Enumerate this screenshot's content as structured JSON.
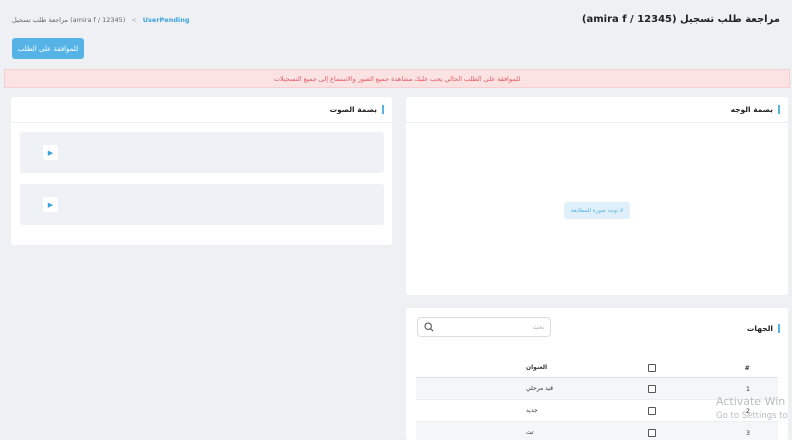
{
  "header": {
    "title": "مراجعة طلب تسجيل (amira f / 12345)",
    "breadcrumb": {
      "link": "UserPending",
      "separator": "<",
      "current": "مراجعة طلب تسجيل (amira f / 12345)"
    }
  },
  "actions": {
    "approve_label": "للموافقة على الطلب"
  },
  "alert": {
    "message": "للموافقة على الطلب الحالي يجب عليك مشاهدة جميع الصور والاستماع إلى جميع التسجيلات"
  },
  "voice_card": {
    "title": "بصمة الصوت",
    "recordings": [
      {
        "play_icon": "▶"
      },
      {
        "play_icon": "▶"
      }
    ]
  },
  "face_card": {
    "title": "بصمة الوجه",
    "no_image_text": "لا توجد صورة للمطابقة"
  },
  "entities_card": {
    "title": "الجهات",
    "search_placeholder": "بحث",
    "table": {
      "headers": {
        "num": "#",
        "address": "العنوان"
      },
      "rows": [
        {
          "num": "1",
          "address": "قيد مرحلي"
        },
        {
          "num": "2",
          "address": "جديد"
        },
        {
          "num": "3",
          "address": "تت"
        }
      ]
    }
  },
  "watermark": {
    "line1": "Activate Win",
    "line2": "Go to Settings to"
  },
  "colors": {
    "accent": "#56b3e6",
    "alert_bg": "#fbe3e4",
    "alert_text": "#e15b62",
    "page_bg": "#eef0f4"
  }
}
